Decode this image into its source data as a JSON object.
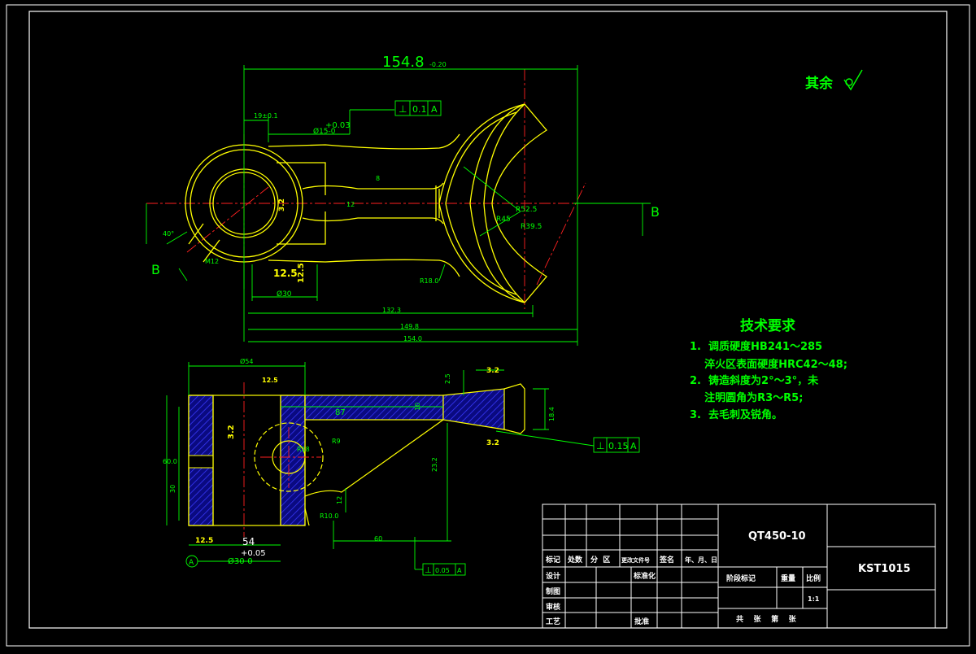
{
  "finish_note": {
    "label": "其余",
    "symbol": "✓"
  },
  "section_labels": {
    "left": "B",
    "right": "B"
  },
  "tech_requirements": {
    "title": "技术要求",
    "items": [
      "1.  调质硬度HB241～285",
      "    淬火区表面硬度HRC42～48;",
      "2.  铸造斜度为2°～3°，未",
      "    注明圆角为R3～R5;",
      "3.  去毛刺及锐角。"
    ]
  },
  "top_view": {
    "overall_dim": "154.8",
    "overall_tol": "-0.20",
    "dim_19": "19±0.1",
    "tol_plus": "+0.03",
    "dim_bore": "Ø15-0",
    "tol_frame_1": [
      "⊥",
      "0.1",
      "A"
    ],
    "dim_8": "8",
    "dim_12": "12",
    "dim_r52": "R52.5",
    "dim_r39": "R39.5",
    "dim_r45": "R45",
    "dim_r18": "R18.0",
    "dim_m12": "M12",
    "dim_30": "Ø30",
    "dim_132": "132.3",
    "dim_149": "149.8",
    "dim_154b": "154.0",
    "rough_12_5a": "12.5",
    "rough_12_5b": "12.5",
    "rough_3_2": "3.2",
    "angle_40": "40°"
  },
  "bottom_view": {
    "dim_54top": "Ø54",
    "rough_12_5": "12.5",
    "rough_3_2a": "3.2",
    "rough_3_2b": "3.2",
    "rough_3_2c": "3.2",
    "dim_2_5": "2.5",
    "dim_87": "87",
    "dim_10": "10",
    "dim_r9": "R9",
    "dim_r18": "R18",
    "dim_60v": "60.0",
    "dim_30v": "30",
    "dim_23": "23.2",
    "dim_12": "12",
    "dim_r10": "R10.0",
    "dim_54": "54",
    "tol_plus": "+0.05",
    "dim_30h": "Ø30-0",
    "dim_60h": "60",
    "dim_18": "18.4",
    "datum": "A",
    "rough_12_5b": "12.5",
    "tol_frame_2": [
      "⊥",
      "0.15",
      "A"
    ],
    "tol_frame_3": [
      "⊥",
      "0.05",
      "A"
    ]
  },
  "title_block": {
    "material": "QT450-10",
    "drawing_no": "KST1015",
    "headers": [
      "标记",
      "处数",
      "分  区",
      "更改文件号",
      "签名",
      "年、月、日"
    ],
    "rows": [
      "设计",
      "制图",
      "审核",
      "工艺"
    ],
    "std": "标准化",
    "approve": "批准",
    "stage": "阶段标记",
    "weight": "重量",
    "scale_label": "比例",
    "scale": "1:1",
    "sheets": "共    张    第    张"
  },
  "colors": {
    "line": "#00ff00",
    "part": "#ffff00",
    "center": "#ff0000",
    "hatch": "#1a1aff",
    "frame": "#ffffff"
  }
}
